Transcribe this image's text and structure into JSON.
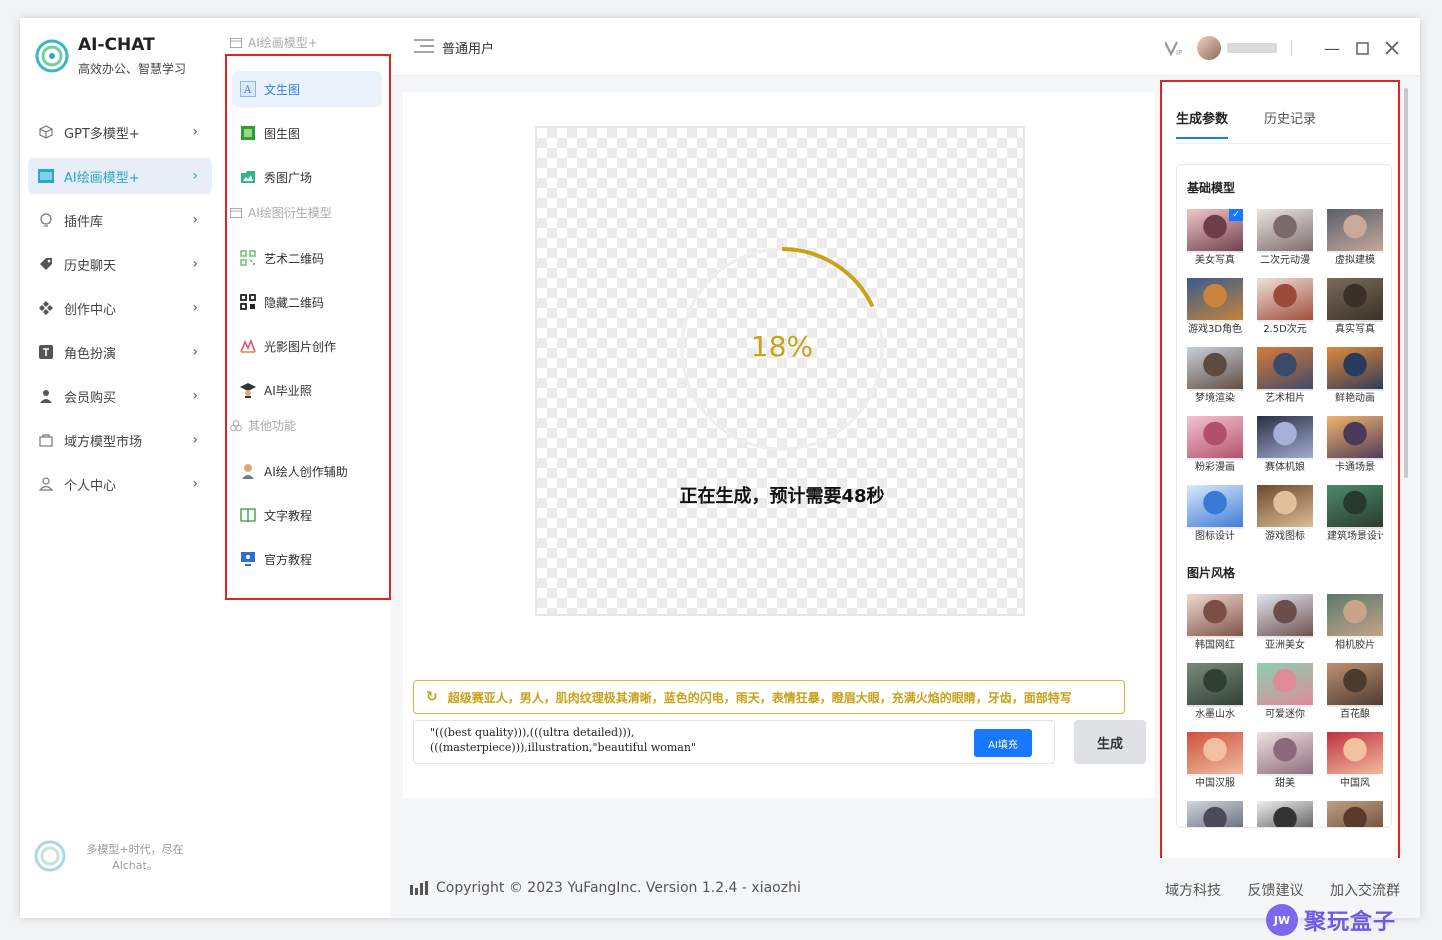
{
  "app": {
    "title": "AI-CHAT",
    "subtitle": "高效办公、智慧学习"
  },
  "sidebar": {
    "items": [
      {
        "label": "GPT多模型+",
        "icon": "cube-icon"
      },
      {
        "label": "AI绘画模型+",
        "icon": "picture-icon",
        "active": true
      },
      {
        "label": "插件库",
        "icon": "bulb-icon"
      },
      {
        "label": "历史聊天",
        "icon": "tag-icon"
      },
      {
        "label": "创作中心",
        "icon": "grid-icon"
      },
      {
        "label": "角色扮演",
        "icon": "t-icon"
      },
      {
        "label": "会员购买",
        "icon": "user-icon"
      },
      {
        "label": "域方模型市场",
        "icon": "bag-icon"
      },
      {
        "label": "个人中心",
        "icon": "person-icon"
      }
    ],
    "footer_text": "多模型+时代，尽在Alchat。"
  },
  "submenu": {
    "section1": "AI绘画模型+",
    "items1": [
      {
        "label": "文生图",
        "active": true
      },
      {
        "label": "图生图"
      },
      {
        "label": "秀图广场"
      }
    ],
    "section2": "AI绘图衍生模型",
    "items2": [
      {
        "label": "艺术二维码"
      },
      {
        "label": "隐藏二维码"
      },
      {
        "label": "光影图片创作"
      },
      {
        "label": "AI毕业照"
      }
    ],
    "section3": "其他功能",
    "items3": [
      {
        "label": "AI绘人创作辅助"
      },
      {
        "label": "文字教程"
      },
      {
        "label": "官方教程"
      }
    ]
  },
  "header": {
    "user_type": "普通用户"
  },
  "canvas": {
    "progress_value": 0.18,
    "progress_text": "18%",
    "status_text": "正在生成，预计需要48秒",
    "accent_color": "#c9a21a"
  },
  "prompt": {
    "suggestion": "超级赛亚人，男人，肌肉纹理极其清晰，蓝色的闪电，雨天，表情狂暴，瞪眉大眼，充满火焰的眼睛，牙齿，面部特写",
    "line1": "\"(((best quality))),(((ultra detailed))),",
    "line2": "(((masterpiece))),illustration,\"beautiful woman\"",
    "ai_fill_label": "AI填充",
    "generate_label": "生成"
  },
  "right_panel": {
    "tabs": [
      "生成参数",
      "历史记录"
    ],
    "group1_title": "基础模型",
    "group1": [
      "美女写真",
      "二次元动漫",
      "虚拟建模",
      "游戏3D角色",
      "2.5D次元",
      "真实写真",
      "梦境渲染",
      "艺术相片",
      "鲜艳动画",
      "粉彩漫画",
      "赛体机娘",
      "卡通场景",
      "图标设计",
      "游戏图标",
      "建筑场景设计"
    ],
    "group2_title": "图片风格",
    "group2": [
      "韩国网红",
      "亚洲美女",
      "相机胶片",
      "水墨山水",
      "可爱迷你",
      "百花酿",
      "中国汉服",
      "甜美",
      "中国风",
      "",
      "",
      ""
    ]
  },
  "footer": {
    "copyright": "Copyright © 2023 YuFangInc. Version 1.2.4 - xiaozhi",
    "links": [
      "域方科技",
      "反馈建议",
      "加入交流群"
    ]
  },
  "watermark": {
    "badge": "JW",
    "text": "聚玩盒子"
  }
}
